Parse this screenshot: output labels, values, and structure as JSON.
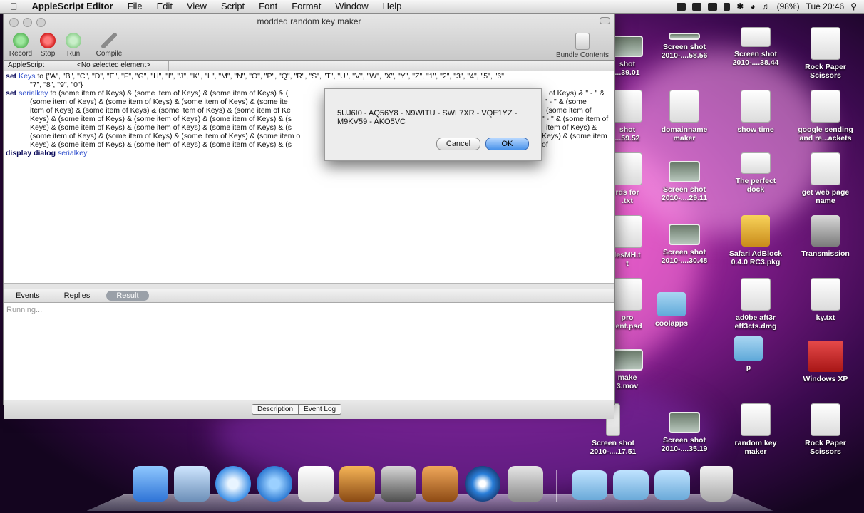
{
  "menubar": {
    "app": "AppleScript Editor",
    "items": [
      "File",
      "Edit",
      "View",
      "Script",
      "Font",
      "Format",
      "Window",
      "Help"
    ],
    "battery": "(98%)",
    "clock": "Tue 20:46"
  },
  "window": {
    "title": "modded random key maker",
    "toolbar": {
      "record": "Record",
      "stop": "Stop",
      "run": "Run",
      "compile": "Compile",
      "bundle": "Bundle Contents"
    },
    "navbar": {
      "language": "AppleScript",
      "element": "<No selected element>"
    },
    "code": {
      "line1a": "set",
      "line1b": "Keys",
      "line1c": "to {\"A\", \"B\", \"C\", \"D\", \"E\", \"F\", \"G\", \"H\", \"I\", \"J\", \"K\", \"L\", \"M\", \"N\", \"O\", \"P\", \"Q\", \"R\", \"S\", \"T\", \"U\", \"V\", \"W\", \"X\", \"Y\", \"Z\", \"1\", \"2\", \"3\", \"4\", \"5\", \"6\",",
      "line2": "\"7\", \"8\", \"9\", \"0\"}",
      "line3a": "set",
      "line3b": "serialkey",
      "line3c": "to (some item of Keys) & (some item of Keys) & (some item of Keys) & (",
      "line3d": "of Keys) & \" - \" &",
      "line4": "(some item of Keys) & (some item of Keys) & (some item of Keys) & (some ite",
      "line4r": "\" - \" & (some",
      "line5": "item of Keys) & (some item of Keys) & (some item of Keys) & (some item of Ke",
      "line5r": "(some item of",
      "line6": "Keys) & (some item of Keys) & (some item of Keys) & (some item of Keys) & (s",
      "line6r": "\" - \" & (some item of",
      "line7": "Keys) & (some item of Keys) & (some item of Keys) & (some item of Keys) & (s",
      "line7r": "item of Keys) &",
      "line8": "(some item of Keys) & (some item of Keys) & (some item of Keys) & (some item o",
      "line8r": "Keys) & (some item of",
      "line9": "Keys) & (some item of Keys) & (some item of Keys) & (some item of Keys) & (s",
      "line10a": "display dialog",
      "line10b": "serialkey"
    },
    "tabs": {
      "events": "Events",
      "replies": "Replies",
      "result": "Result"
    },
    "result_text": "Running...",
    "bottom": {
      "description": "Description",
      "event_log": "Event Log"
    }
  },
  "dialog": {
    "message": "5UJ6I0 - AQ56Y8 - N9WITU - SWL7XR - VQE1YZ - M9KV59 - AKO5VC",
    "cancel": "Cancel",
    "ok": "OK"
  },
  "desktop": {
    "c1": [
      "shot\n...39.01",
      "shot\n...59.52",
      "rds for\n.txt",
      "lesMH.t\nt",
      "pro\nrent.psd",
      "make\n3.mov",
      "Screen shot\n2010-....17.51"
    ],
    "c2": [
      "Screen shot\n2010-....58.56",
      "domainname\nmaker",
      "Screen shot\n2010-....29.11",
      "Screen shot\n2010-....30.48",
      "coolapps",
      "Screen shot\n2010-....35.19"
    ],
    "c3": [
      "Screen shot\n2010-....38.44",
      "show time",
      "The perfect\ndock",
      "Safari AdBlock\n0.4.0 RC3.pkg",
      "ad0be aft3r\neff3cts.dmg",
      "p",
      "random key\nmaker"
    ],
    "c4": [
      "Rock Paper\nScissors",
      "google sending\nand re...ackets",
      "get web page\nname",
      "Transmission",
      "ky.txt",
      "Windows XP",
      "Rock Paper\nScissors"
    ]
  }
}
